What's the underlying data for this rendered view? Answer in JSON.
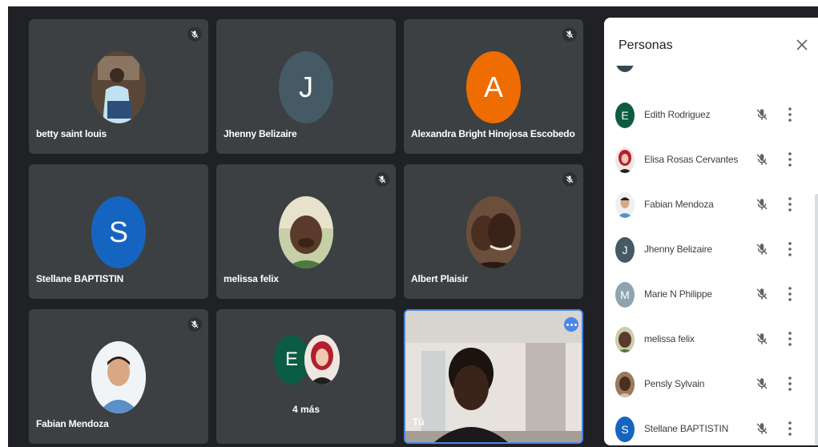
{
  "tiles": [
    {
      "name": "betty saint louis",
      "avatar_type": "photo",
      "muted": true
    },
    {
      "name": "Jhenny Belizaire",
      "avatar_type": "letter",
      "initial": "J",
      "color": "#455a64",
      "muted": false
    },
    {
      "name": "Alexandra Bright Hinojosa Escobedo",
      "avatar_type": "letter",
      "initial": "A",
      "color": "#ef6c00",
      "muted": true
    },
    {
      "name": "Stellane BAPTISTIN",
      "avatar_type": "letter",
      "initial": "S",
      "color": "#1565c0",
      "muted": false
    },
    {
      "name": "melissa felix",
      "avatar_type": "photo",
      "muted": true
    },
    {
      "name": "Albert Plaisir",
      "avatar_type": "photo",
      "muted": true
    },
    {
      "name": "Fabian Mendoza",
      "avatar_type": "photo",
      "muted": true
    }
  ],
  "overflow_tile": {
    "initial": "E",
    "color": "#0b5c43",
    "label": "4 más"
  },
  "self_tile": {
    "label": "Tú",
    "accent": "#4a86e8"
  },
  "people_panel": {
    "title": "Personas",
    "close_icon": "close-icon",
    "participants": [
      {
        "name": "Edith Rodriguez",
        "avatar_type": "letter",
        "initial": "E",
        "color": "#0b5c43"
      },
      {
        "name": "Elisa Rosas Cervantes",
        "avatar_type": "photo"
      },
      {
        "name": "Fabian Mendoza",
        "avatar_type": "photo"
      },
      {
        "name": "Jhenny Belizaire",
        "avatar_type": "letter",
        "initial": "J",
        "color": "#455a64"
      },
      {
        "name": "Marie N Philippe",
        "avatar_type": "letter",
        "initial": "M",
        "color": "#90a4ae"
      },
      {
        "name": "melissa felix",
        "avatar_type": "photo"
      },
      {
        "name": "Pensly Sylvain",
        "avatar_type": "photo"
      },
      {
        "name": "Stellane BAPTISTIN",
        "avatar_type": "letter",
        "initial": "S",
        "color": "#1565c0"
      }
    ]
  }
}
